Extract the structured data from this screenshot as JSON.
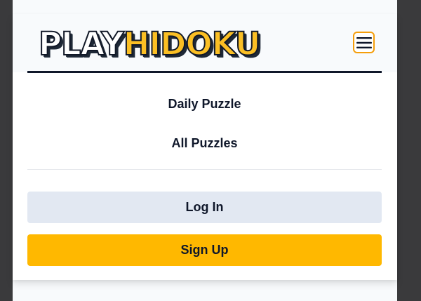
{
  "logo": {
    "part1": "PLAY",
    "part2": "HIDOKU"
  },
  "header": {
    "menu_icon": "hamburger-menu-icon"
  },
  "nav": {
    "items": [
      {
        "label": "Daily Puzzle"
      },
      {
        "label": "All Puzzles"
      }
    ]
  },
  "auth": {
    "login_label": "Log In",
    "signup_label": "Sign Up"
  },
  "colors": {
    "accent": "#ffb800",
    "hamburger_border": "#f59e0b",
    "login_bg": "#e2e8f2",
    "text": "#0f172a",
    "logo_yellow": "#fbbf24"
  }
}
